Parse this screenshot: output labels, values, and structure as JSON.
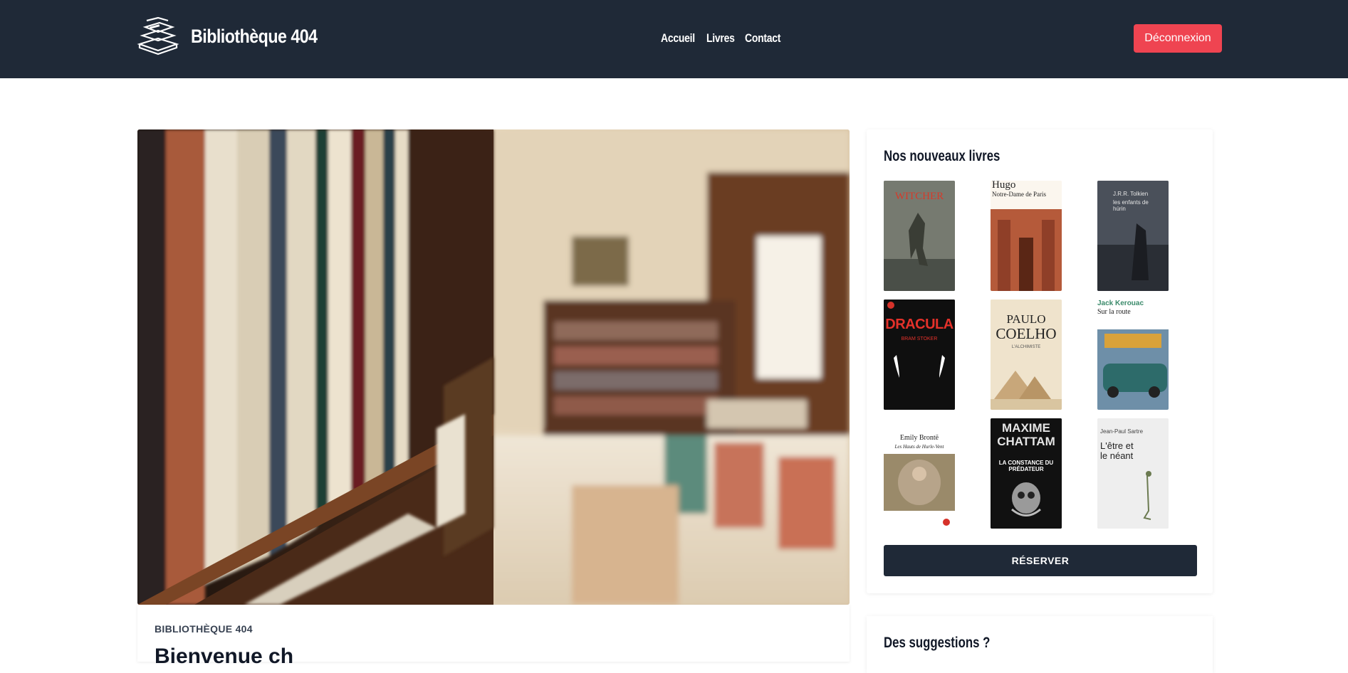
{
  "header": {
    "brand": "Bibliothèque 404",
    "nav": [
      {
        "label": "Accueil"
      },
      {
        "label": "Livres"
      },
      {
        "label": "Contact"
      }
    ],
    "logout_label": "Déconnexion",
    "logout_color": "#ef4451",
    "background": "#1f2937"
  },
  "hero": {
    "image_icon": "library-shelves-photo"
  },
  "article": {
    "kicker": "BIBLIOTHÈQUE 404",
    "title": "Bienvenue ch"
  },
  "sidebar": {
    "new_books_title": "Nos nouveaux livres",
    "books": [
      {
        "author": "",
        "title": "WITCHER"
      },
      {
        "author": "Hugo",
        "title": "Notre-Dame de Paris"
      },
      {
        "author": "J.R.R. Tolkien",
        "title": "les enfants de húrin"
      },
      {
        "author": "BRAM STOKER",
        "title": "DRACULA"
      },
      {
        "author": "PAULO",
        "title": "COELHO",
        "subtitle": "L'ALCHIMISTE"
      },
      {
        "author": "Jack Kerouac",
        "title": "Sur la route"
      },
      {
        "author": "Emily Brontë",
        "title": "Les Hauts de Hurle-Vent"
      },
      {
        "author": "MAXIME CHATTAM",
        "title": "LA CONSTANCE DU PRÉDATEUR"
      },
      {
        "author": "Jean-Paul Sartre",
        "title": "L'être et le néant"
      }
    ],
    "reserve_label": "RÉSERVER",
    "suggestions_title": "Des suggestions ?"
  }
}
